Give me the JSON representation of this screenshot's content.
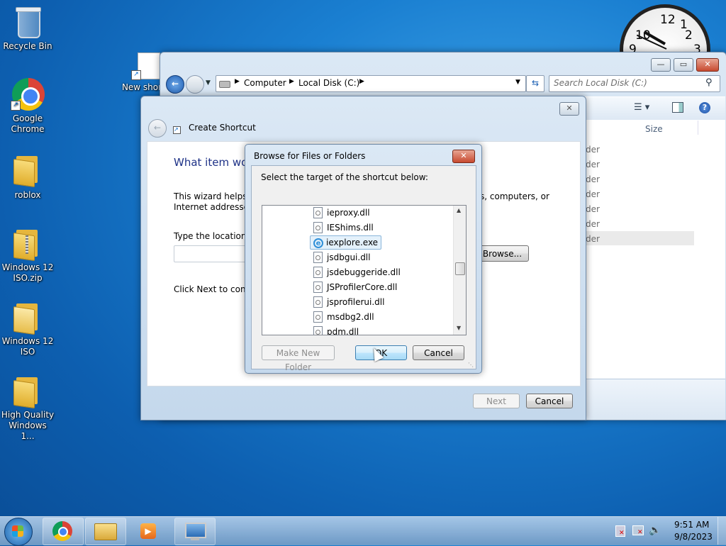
{
  "desktop": {
    "icons": [
      {
        "label": "Recycle Bin"
      },
      {
        "label": "Google Chrome"
      },
      {
        "label": "roblox"
      },
      {
        "label": "Windows 12 ISO.zip"
      },
      {
        "label": "Windows 12 ISO"
      },
      {
        "label": "High Quality Windows 1..."
      },
      {
        "label": "New shor"
      }
    ]
  },
  "clock": {
    "numbers": [
      "12",
      "1",
      "2",
      "10",
      "9",
      "3"
    ]
  },
  "explorer": {
    "breadcrumb": [
      "Computer",
      "Local Disk (C:)"
    ],
    "search_placeholder": "Search Local Disk (C:)",
    "column_size": "Size",
    "rows": [
      "der",
      "der",
      "der",
      "der",
      "der",
      "der",
      "der"
    ]
  },
  "wizard": {
    "title": "Create Shortcut",
    "heading": "What item wou",
    "desc_line1": "This wizard helps y",
    "desc_line2": "Internet addresses.",
    "desc_right": "s, computers, or",
    "location_label": "Type the location o",
    "location_value": "",
    "browse_label": "Browse...",
    "click_next": "Click Next to contin",
    "next_label": "Next",
    "cancel_label": "Cancel"
  },
  "browse_dialog": {
    "title": "Browse for Files or Folders",
    "instruction": "Select the target of the shortcut below:",
    "items": [
      {
        "name": "ieproxy.dll",
        "selected": false
      },
      {
        "name": "IEShims.dll",
        "selected": false
      },
      {
        "name": "iexplore.exe",
        "selected": true
      },
      {
        "name": "jsdbgui.dll",
        "selected": false
      },
      {
        "name": "jsdebuggeride.dll",
        "selected": false
      },
      {
        "name": "JSProfilerCore.dll",
        "selected": false
      },
      {
        "name": "jsprofilerui.dll",
        "selected": false
      },
      {
        "name": "msdbg2.dll",
        "selected": false
      },
      {
        "name": "pdm.dll",
        "selected": false
      }
    ],
    "make_new_folder_label": "Make New Folder",
    "ok_label": "OK",
    "cancel_label": "Cancel"
  },
  "taskbar": {
    "time": "9:51 AM",
    "date": "9/8/2023"
  }
}
